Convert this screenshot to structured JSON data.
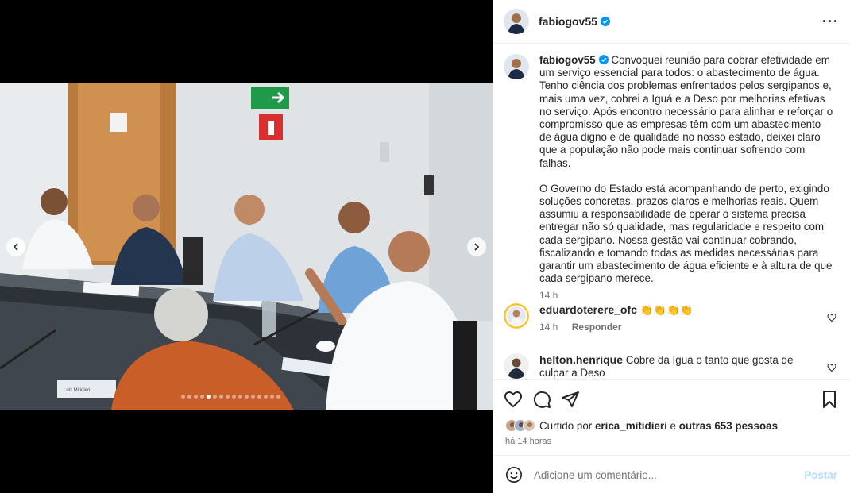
{
  "post": {
    "username": "fabiogov55",
    "caption_p1": "Convoquei reunião para cobrar efetividade em um serviço essencial para todos: o abastecimento de água. Tenho ciência dos problemas enfrentados pelos sergipanos e, mais uma vez, cobrei a Iguá e a Deso por melhorias efetivas no serviço. Após encontro necessário para alinhar e reforçar o compromisso que as empresas têm com um abastecimento de água digno e de qualidade no nosso estado, deixei claro que a população não pode mais continuar sofrendo com falhas.",
    "caption_p2": "O Governo do Estado está acompanhando de perto, exigindo soluções concretas, prazos claros e melhorias reais. Quem assumiu a responsabilidade de operar o sistema precisa entregar não só qualidade, mas regularidade e respeito com cada sergipano. Nossa gestão vai continuar cobrando, fiscalizando e tomando todas as medidas necessárias para garantir um abastecimento de água eficiente e à altura de que cada sergipano merece.",
    "caption_time": "14 h",
    "more_icon": "more-horizontal-icon",
    "carousel": {
      "total": 16,
      "active": 4
    },
    "photo_signs": {
      "nameplate": "Luiz Mitidieri"
    }
  },
  "comments": [
    {
      "username": "eduardoterere_ofc",
      "text": "👏👏👏👏",
      "time": "14 h",
      "reply": "Responder"
    },
    {
      "username": "helton.henrique",
      "text": "Cobre da Iguá o tanto que gosta de culpar a Deso"
    }
  ],
  "likes": {
    "prefix": "Curtido por",
    "user": "erica_mitidieri",
    "conj": "e",
    "others": "outras 653 pessoas",
    "ago": "há 14 horas"
  },
  "composer": {
    "placeholder": "Adicione um comentário...",
    "post_label": "Postar"
  },
  "colors": {
    "verified": "#0095f6",
    "post_disabled": "#b3dbff",
    "muted": "#737373",
    "text": "#262626"
  }
}
